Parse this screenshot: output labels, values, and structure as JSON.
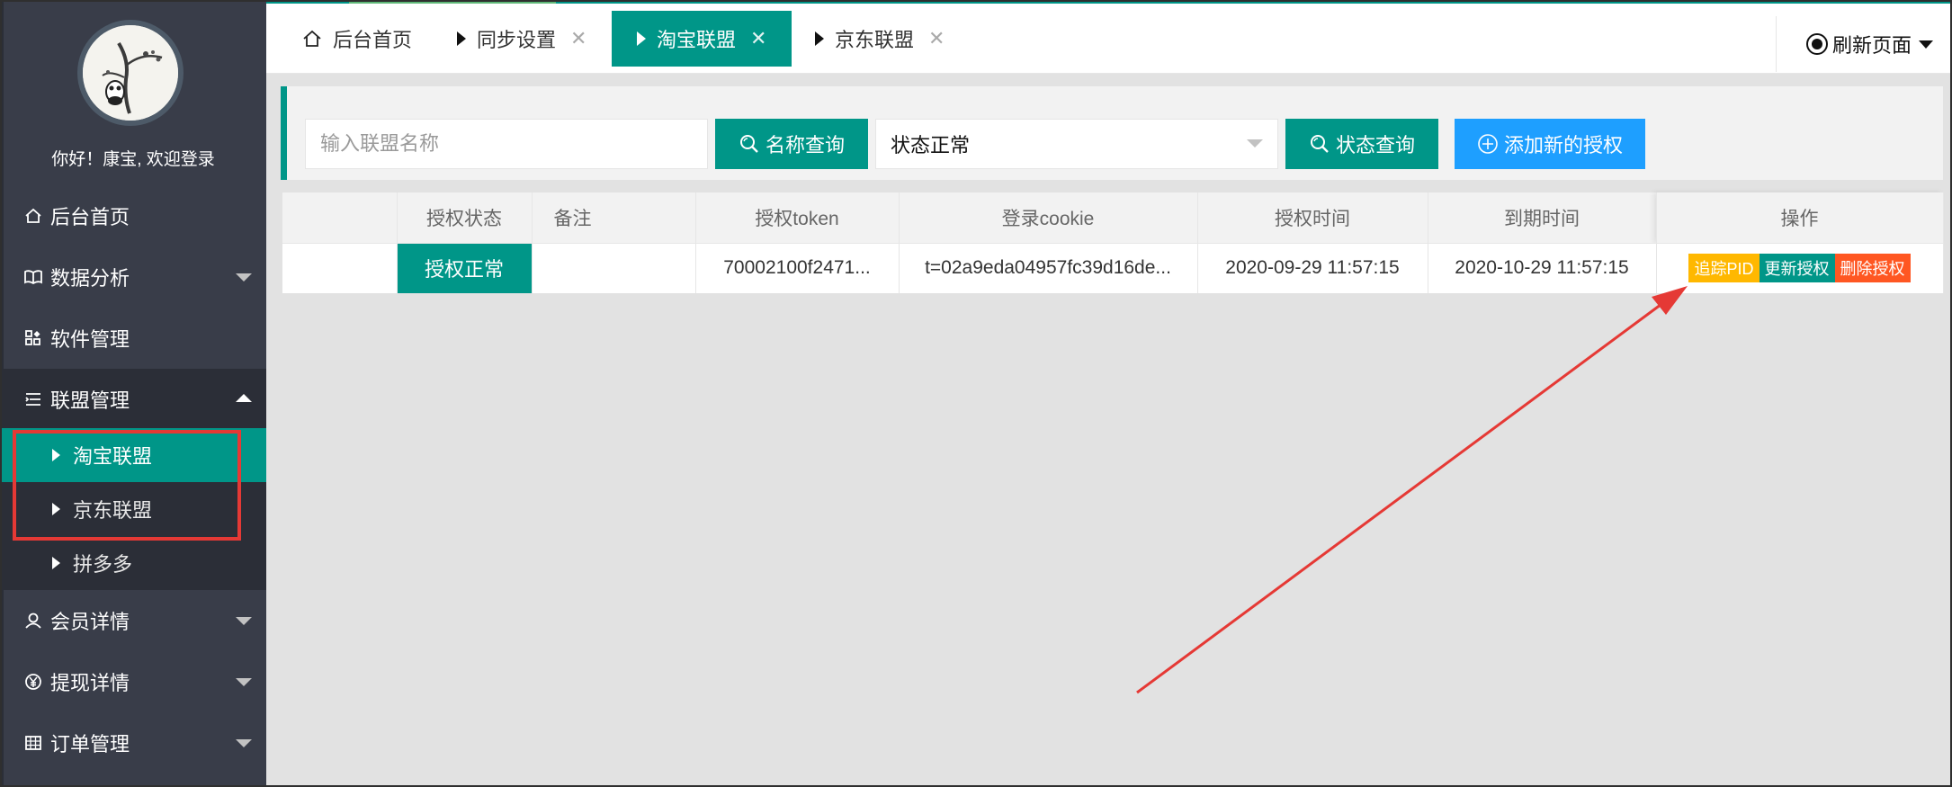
{
  "sidebar": {
    "welcome": "你好！康宝, 欢迎登录",
    "items": [
      {
        "label": "后台首页",
        "icon": "home-icon"
      },
      {
        "label": "数据分析",
        "icon": "book-icon"
      },
      {
        "label": "软件管理",
        "icon": "apps-icon"
      },
      {
        "label": "联盟管理",
        "icon": "list-icon",
        "expanded": true
      },
      {
        "label": "会员详情",
        "icon": "user-icon"
      },
      {
        "label": "提现详情",
        "icon": "yen-icon"
      },
      {
        "label": "订单管理",
        "icon": "grid-icon"
      }
    ],
    "sub_items": [
      {
        "label": "淘宝联盟",
        "active": true
      },
      {
        "label": "京东联盟"
      },
      {
        "label": "拼多多"
      }
    ]
  },
  "tabs": [
    {
      "label": "后台首页",
      "icon": "home-icon"
    },
    {
      "label": "同步设置",
      "closable": true
    },
    {
      "label": "淘宝联盟",
      "closable": true,
      "active": true
    },
    {
      "label": "京东联盟",
      "closable": true
    }
  ],
  "refresh_label": "刷新页面",
  "filter": {
    "name_placeholder": "输入联盟名称",
    "name_search_label": "名称查询",
    "status_selected": "状态正常",
    "status_search_label": "状态查询",
    "add_label": "添加新的授权"
  },
  "table": {
    "headers": [
      "",
      "授权状态",
      "备注",
      "授权token",
      "登录cookie",
      "授权时间",
      "到期时间",
      "操作"
    ],
    "rows": [
      {
        "blank": "",
        "status": "授权正常",
        "note": "",
        "token": "70002100f2471...",
        "cookie": "t=02a9eda04957fc39d16de...",
        "auth_time": "2020-09-29 11:57:15",
        "expire_time": "2020-10-29 11:57:15",
        "actions": [
          "追踪PID",
          "更新授权",
          "删除授权"
        ]
      }
    ]
  },
  "colors": {
    "sidebar_bg": "#393d49",
    "accent": "#009688",
    "blue": "#1e9fff",
    "orange": "#ffb800",
    "red": "#ff5722",
    "annotation": "#e53935"
  }
}
